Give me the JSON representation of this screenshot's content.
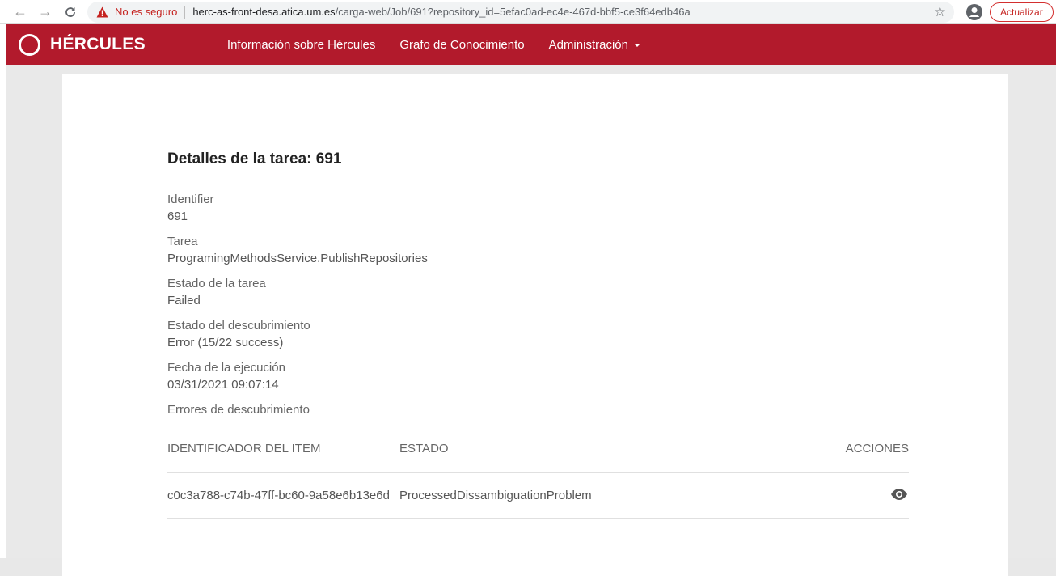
{
  "browser": {
    "security_label": "No es seguro",
    "url_host": "herc-as-front-desa.atica.um.es",
    "url_path": "/carga-web/Job/691?repository_id=5efac0ad-ec4e-467d-bbf5-ce3f64edb46a",
    "update_label": "Actualizar"
  },
  "navbar": {
    "brand": "HÉRCULES",
    "links": [
      {
        "label": "Información sobre Hércules"
      },
      {
        "label": "Grafo de Conocimiento"
      },
      {
        "label": "Administración"
      }
    ]
  },
  "page": {
    "title": "Detalles de la tarea: 691",
    "fields": [
      {
        "label": "Identifier",
        "value": "691"
      },
      {
        "label": "Tarea",
        "value": "ProgramingMethodsService.PublishRepositories"
      },
      {
        "label": "Estado de la tarea",
        "value": "Failed"
      },
      {
        "label": "Estado del descubrimiento",
        "value": "Error (15/22 success)"
      },
      {
        "label": "Fecha de la ejecución",
        "value": "03/31/2021 09:07:14"
      }
    ],
    "errors_label": "Errores de descubrimiento",
    "table": {
      "headers": [
        "IDENTIFICADOR DEL ITEM",
        "ESTADO",
        "ACCIONES"
      ],
      "rows": [
        {
          "id": "c0c3a788-c74b-47ff-bc60-9a58e6b13e6d",
          "status": "ProcessedDissambiguationProblem",
          "action_icon": "eye-icon"
        }
      ]
    }
  }
}
